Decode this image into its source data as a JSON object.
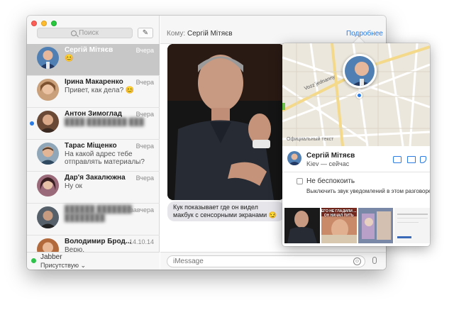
{
  "sidebar": {
    "search_placeholder": "Поиск",
    "compose_icon": "compose-icon",
    "conversations": [
      {
        "name": "Сергій Мітяєв",
        "time": "Вчера",
        "preview": "😊",
        "selected": true,
        "unread": false
      },
      {
        "name": "Ірина Макаренко",
        "time": "Вчера",
        "preview": "Привет, как дела? 😊",
        "selected": false,
        "unread": false
      },
      {
        "name": "Антон Зимоглад",
        "time": "Вчера",
        "preview": "",
        "selected": false,
        "unread": true
      },
      {
        "name": "Тарас Міщенко",
        "time": "Вчера",
        "preview": "На какой адрес тебе отправлять материалы?",
        "selected": false,
        "unread": false
      },
      {
        "name": "Дар'я Закалюжна",
        "time": "Вчера",
        "preview": "Ну ок",
        "selected": false,
        "unread": false
      },
      {
        "name": "",
        "time": "Позавчера",
        "preview": "",
        "selected": false,
        "unread": false
      },
      {
        "name": "Володимир Брод...",
        "time": "14.10.14",
        "preview": "Верю.",
        "selected": false,
        "unread": false
      }
    ],
    "account": "Jabber",
    "presence": "Присутствую ⌄"
  },
  "main": {
    "to_label": "Кому:",
    "to_name": "Сергій Мітяєв",
    "details_link": "Подробнее",
    "message_text": "Кук показывает где он видел макбук с сенсорными экранами 😏",
    "input_placeholder": "iMessage"
  },
  "popover": {
    "map_caption": "Официальный текст",
    "map_street": "Vozz`jednanny",
    "contact_name": "Сергій Мітяєв",
    "contact_location": "Kiev — сейчас",
    "dnd_label": "Не беспокоить",
    "dnd_sub": "Выключить звук уведомлений в этом разговоре",
    "thumb_captions": [
      "",
      "ЕГО НЕ ГЛАДИЛИ ... ОН НАЧАЛ ПИТЬ",
      "",
      ""
    ]
  },
  "colors": {
    "accent": "#2a7be4",
    "selected_row": "#c7c7c7",
    "bubble_gray": "#e5e5ea",
    "online": "#2ec24a"
  }
}
